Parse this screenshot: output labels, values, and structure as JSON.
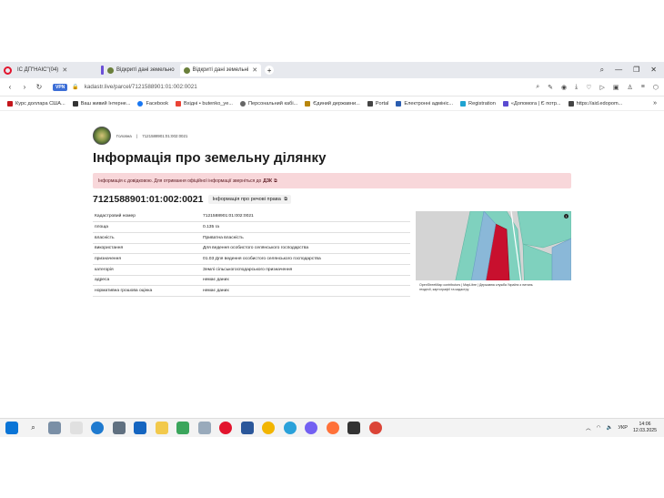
{
  "browser": {
    "tabs": [
      {
        "label": "ІС ДП\"НАІС\"(04)"
      },
      {
        "label": "Відкриті дані земельно"
      },
      {
        "label": "Відкриті дані земельні"
      }
    ],
    "url": "kadastr.live/parcel/7121588901:01:002:0021",
    "vpn_label": "VPN"
  },
  "bookmarks": [
    {
      "label": "Курс доллара США...",
      "color": "#c4161c"
    },
    {
      "label": "Ваш живий Інтерне...",
      "color": "#333333"
    },
    {
      "label": "Facebook",
      "color": "#1877f2"
    },
    {
      "label": "Вхідні • butenko_ye...",
      "color": "#ea4335"
    },
    {
      "label": "Персональний кабі...",
      "color": "#666666"
    },
    {
      "label": "Єдиний державни...",
      "color": "#b8860b"
    },
    {
      "label": "Portal",
      "color": "#444444"
    },
    {
      "label": "Електронні адмініс...",
      "color": "#2a5db0"
    },
    {
      "label": "Registration",
      "color": "#1fa3d1"
    },
    {
      "label": "«Допомога | Є потр...",
      "color": "#5a4bd1"
    },
    {
      "label": "https://aid.edopom...",
      "color": "#444444"
    }
  ],
  "breadcrumb": {
    "home": "Головна",
    "separator": "|",
    "current": "7121588901:01:002:0021"
  },
  "page": {
    "title": "Інформація про земельну ділянку",
    "alert_text": "Інформація є довідковою. Для отримання офіційної інформації зверніться до",
    "alert_link": "ДЗК",
    "parcel_id": "7121588901:01:002:0021",
    "rights_button": "Інформація про речові права"
  },
  "details": [
    {
      "key": "Кадастровий номер",
      "value": "7121588901:01:002:0021"
    },
    {
      "key": "площа",
      "value": "0.135 га"
    },
    {
      "key": "власність",
      "value": "Приватна власність"
    },
    {
      "key": "використання",
      "value": "Для ведення особистого селянського господарства"
    },
    {
      "key": "призначення",
      "value": "01.03 Для ведення особистого селянського господарства"
    },
    {
      "key": "категорія",
      "value": "Землі сільськогосподарського призначення"
    },
    {
      "key": "адреса",
      "value": "немає даних"
    },
    {
      "key": "нормативна грошова оцінка",
      "value": "немає даних"
    }
  ],
  "map": {
    "attribution_1": "OpenStreetMap contributors | MapLibre",
    "attribution_2": "| Державна служба України з питань",
    "attribution_3": "геодезії, картографії та кадастру",
    "info_glyph": "i",
    "colors": {
      "parcel": "#c8102e",
      "neighbor": "#7fd1be",
      "water": "#8ab8d8",
      "background": "#d4d4d4"
    }
  },
  "taskbar": {
    "language": "УКР",
    "time": "14:06",
    "date": "12.03.2025"
  }
}
